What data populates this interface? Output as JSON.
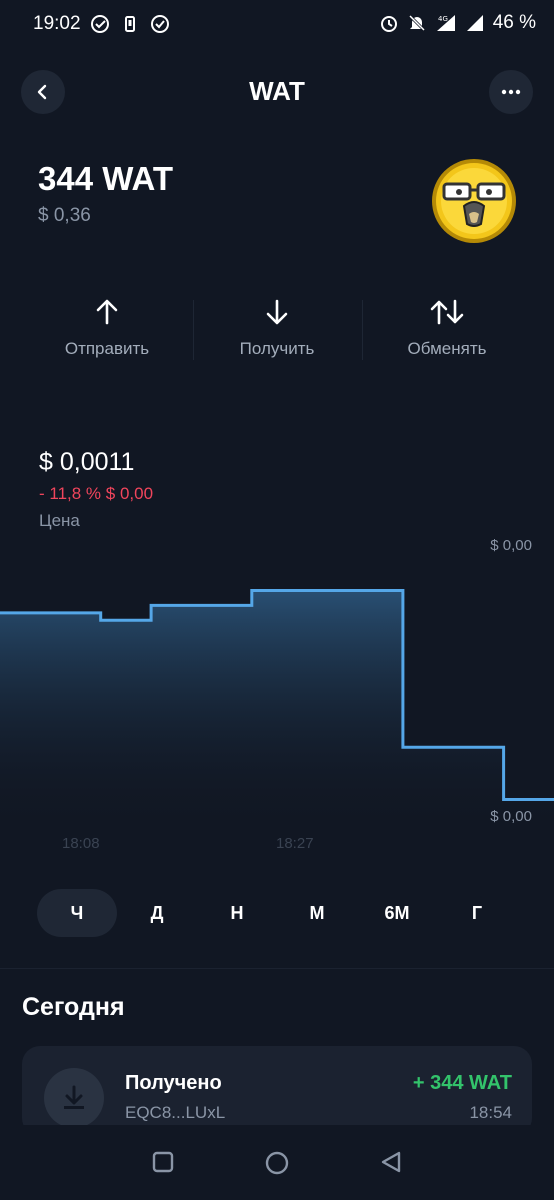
{
  "status_bar": {
    "time": "19:02",
    "battery": "46 %",
    "network": "4G"
  },
  "header": {
    "title": "WAT"
  },
  "asset": {
    "balance": "344 WAT",
    "fiat_value": "$ 0,36"
  },
  "actions": [
    {
      "label": "Отправить",
      "icon": "arrow-up-icon"
    },
    {
      "label": "Получить",
      "icon": "arrow-down-icon"
    },
    {
      "label": "Обменять",
      "icon": "swap-icon"
    }
  ],
  "price": {
    "value": "$ 0,0011",
    "change": "- 11,8 % $ 0,00",
    "label": "Цена"
  },
  "chart": {
    "y_max_label": "$ 0,00",
    "y_min_label": "$ 0,00",
    "x_labels": [
      "18:08",
      "18:27"
    ]
  },
  "chart_data": {
    "type": "area",
    "step": true,
    "x_ticks": [
      "18:08",
      "18:27"
    ],
    "values": [
      0.0012,
      0.0012,
      0.00119,
      0.00121,
      0.00121,
      0.00123,
      0.00123,
      0.00123,
      0.00102,
      0.00102,
      0.00095
    ],
    "color": "#55a7e8"
  },
  "periods": [
    "Ч",
    "Д",
    "Н",
    "М",
    "6М",
    "Г"
  ],
  "active_period": "Ч",
  "history": {
    "section_title": "Сегодня",
    "items": [
      {
        "title": "Получено",
        "address": "EQC8...LUxL",
        "amount": "+ 344 WAT",
        "time": "18:54"
      }
    ]
  },
  "colors": {
    "background": "#111723",
    "accent": "#55a7e8",
    "negative": "#f0455c",
    "positive": "#33c36b"
  }
}
